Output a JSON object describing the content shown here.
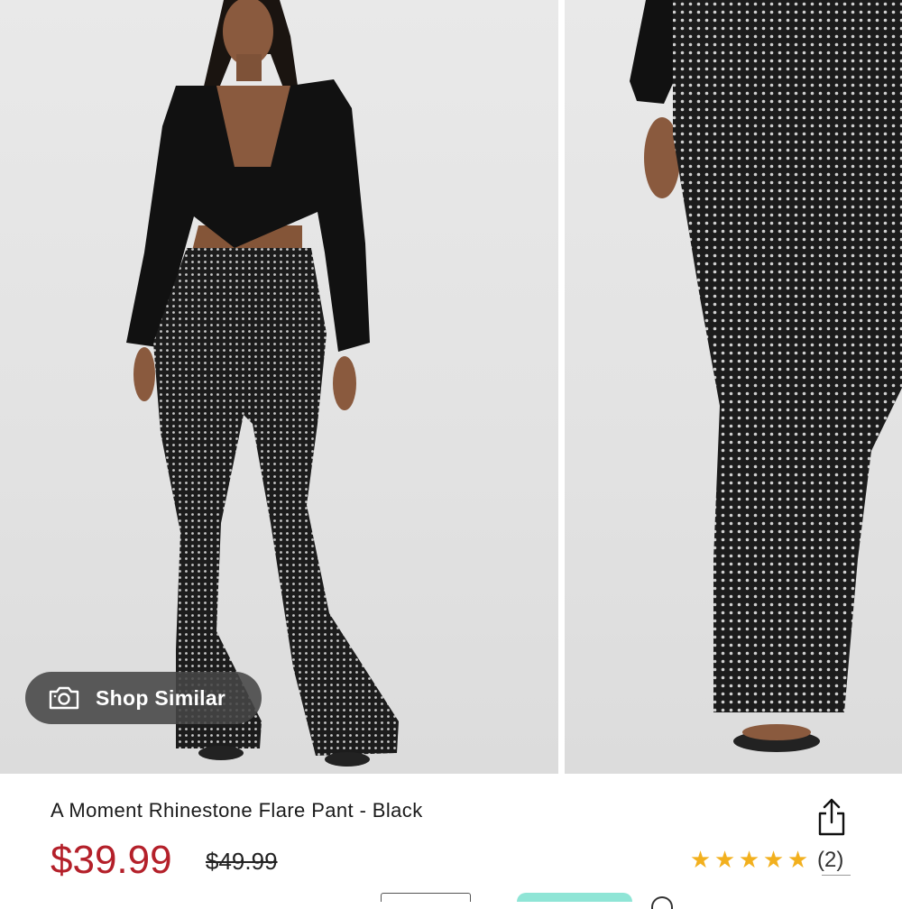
{
  "product": {
    "title": "A Moment Rhinestone Flare Pant - Black",
    "price": "$39.99",
    "original_price": "$49.99",
    "rating": {
      "stars": 5,
      "count_label": "(2)"
    }
  },
  "gallery": {
    "shop_similar_label": "Shop Similar",
    "images": [
      "model-front-photo",
      "pant-detail-photo"
    ]
  },
  "icons": {
    "camera": "camera-icon",
    "share": "share-icon",
    "star": "star-icon"
  },
  "colors": {
    "price": "#b4202a",
    "star": "#f2b01e",
    "pill_bg": "#464646",
    "accent_button": "#8fe5d6"
  }
}
